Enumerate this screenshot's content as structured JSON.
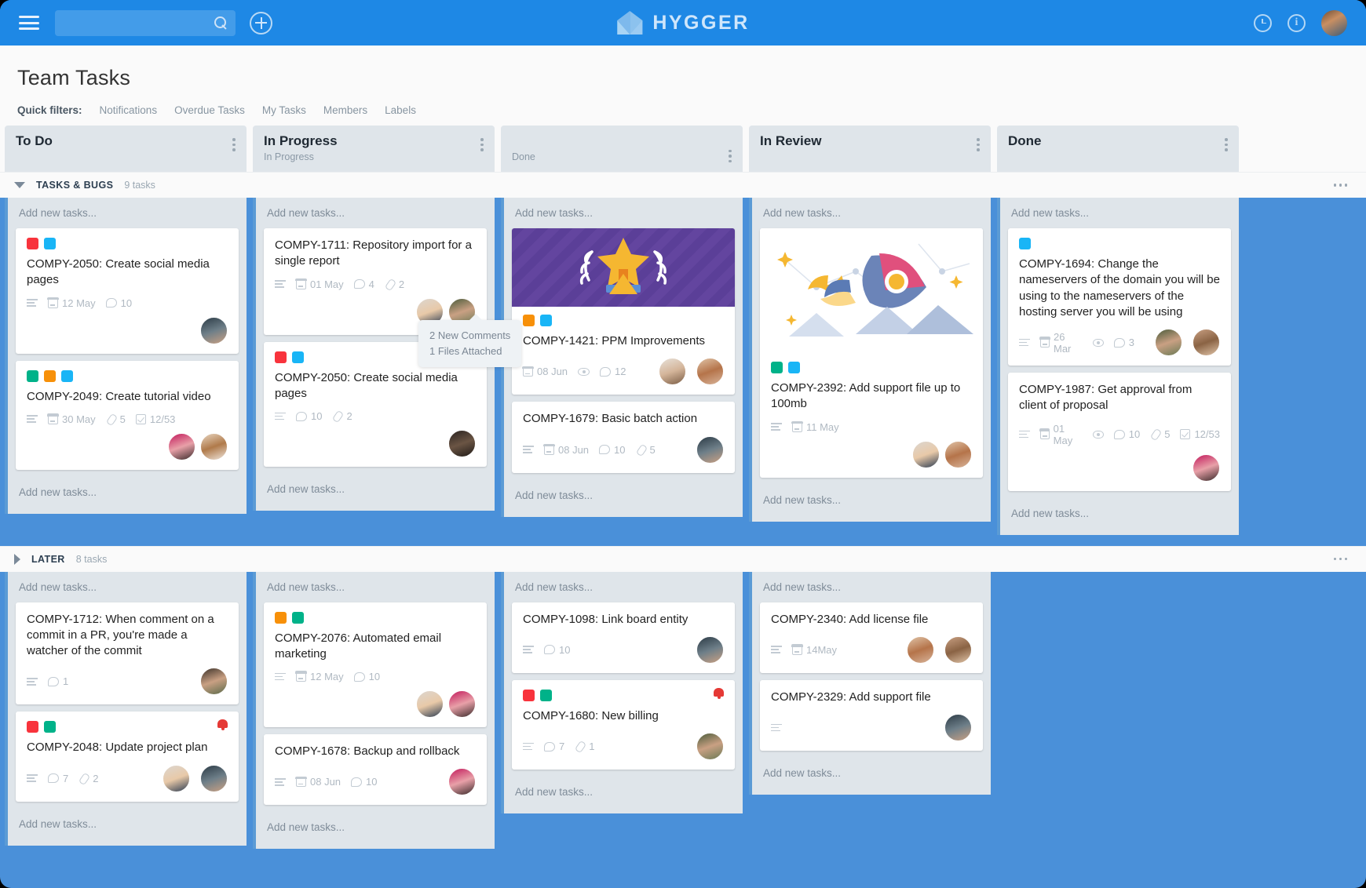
{
  "topbar": {
    "menu_icon": "hamburger-icon",
    "search_placeholder": "",
    "search_value": "",
    "add_icon": "plus-circle-icon",
    "brand": "HYGGER",
    "clock_icon": "clock-icon",
    "info_icon": "info-icon",
    "avatar": "user-avatar"
  },
  "page": {
    "title": "Team Tasks",
    "filters_label": "Quick filters:",
    "filters": [
      "Notifications",
      "Overdue Tasks",
      "My Tasks",
      "Members",
      "Labels"
    ]
  },
  "columns": [
    {
      "title": "To Do",
      "subtitle": ""
    },
    {
      "title": "In Progress",
      "subtitle": "In Progress"
    },
    {
      "title": "",
      "subtitle": "Done"
    },
    {
      "title": "In Review",
      "subtitle": ""
    },
    {
      "title": "Done",
      "subtitle": ""
    }
  ],
  "add_new_text": "Add new tasks...",
  "swimlanes": [
    {
      "name": "TASKS & BUGS",
      "count": "9 tasks",
      "expanded": true
    },
    {
      "name": "LATER",
      "count": "8 tasks",
      "expanded": false
    }
  ],
  "tooltip": {
    "line1": "2 New Comments",
    "line2": "1 Files Attached"
  },
  "label_colors": {
    "red": "#f8333c",
    "cyan": "#19b5f6",
    "green": "#00b289",
    "orange": "#f79009",
    "blue": "#19b5f6"
  },
  "lane1": {
    "todo": [
      {
        "labels": [
          "red",
          "cyan"
        ],
        "title": "COMPY-2050: Create social media pages",
        "desc": true,
        "date": "12 May",
        "comments": "10",
        "avatars": 1
      },
      {
        "labels": [
          "green",
          "orange",
          "cyan"
        ],
        "title": "COMPY-2049: Create tutorial video",
        "desc": true,
        "date": "30 May",
        "files": "5",
        "checklist": "12/53",
        "avatars": 2
      }
    ],
    "inprogress": [
      {
        "labels": [],
        "title": "COMPY-1711: Repository import for a single report",
        "desc": true,
        "date": "01 May",
        "comments": "4",
        "files": "2",
        "avatars": 2
      },
      {
        "labels": [
          "red",
          "cyan"
        ],
        "title": "COMPY-2050: Create social media pages",
        "desc": true,
        "comments": "10",
        "files": "2",
        "avatars": 1,
        "bell": true,
        "tooltip": true
      }
    ],
    "done1": [
      {
        "cover": "trophy",
        "labels": [
          "orange",
          "cyan"
        ],
        "title": "COMPY-1421: PPM Improvements",
        "date": "08 Jun",
        "watch": true,
        "comments": "12",
        "avatars": 2
      },
      {
        "labels": [],
        "title": "COMPY-1679: Basic batch action",
        "desc": true,
        "date": "08 Jun",
        "comments": "10",
        "files": "5",
        "avatars": 1
      }
    ],
    "inreview": [
      {
        "cover": "rocket",
        "labels": [
          "green",
          "cyan"
        ],
        "title": "COMPY-2392: Add support file up to 100mb",
        "desc": true,
        "date": "11 May",
        "avatars": 2
      }
    ],
    "done2": [
      {
        "labels": [
          "cyan"
        ],
        "title": "COMPY-1694: Change the nameservers of the domain you will be using to the nameservers of the hosting server you will be using",
        "desc": true,
        "date": "26 Mar",
        "watch": true,
        "comments": "3",
        "avatars": 2
      },
      {
        "labels": [],
        "title": "COMPY-1987: Get approval from client of proposal",
        "desc": true,
        "date": "01 May",
        "watch": true,
        "comments": "10",
        "files": "5",
        "checklist": "12/53",
        "avatars": 1
      }
    ]
  },
  "lane2": {
    "todo": [
      {
        "labels": [],
        "title": "COMPY-1712: When comment on a commit in a PR, you're made a watcher of the commit",
        "desc": true,
        "comments": "1",
        "avatars": 1
      },
      {
        "labels": [
          "red",
          "green"
        ],
        "title": "COMPY-2048: Update project plan",
        "desc": true,
        "comments": "7",
        "files": "2",
        "avatars": 2,
        "bell": true
      }
    ],
    "inprogress": [
      {
        "labels": [
          "orange",
          "green"
        ],
        "title": "COMPY-2076: Automated email marketing",
        "desc": true,
        "date": "12 May",
        "comments": "10",
        "avatars": 2
      },
      {
        "labels": [],
        "title": "COMPY-1678: Backup and rollback",
        "desc": true,
        "date": "08 Jun",
        "comments": "10",
        "avatars": 1
      }
    ],
    "done1": [
      {
        "labels": [],
        "title": "COMPY-1098: Link board entity",
        "desc": true,
        "comments": "10",
        "avatars": 1
      },
      {
        "labels": [
          "red",
          "green"
        ],
        "title": "COMPY-1680: New billing",
        "desc": true,
        "comments": "7",
        "files": "1",
        "avatars": 1,
        "bell": true
      }
    ],
    "inreview": [
      {
        "labels": [],
        "title": "COMPY-2340: Add license file",
        "desc": true,
        "date": "14May",
        "avatars": 2
      },
      {
        "labels": [],
        "title": "COMPY-2329: Add support file",
        "desc": true,
        "avatars": 1
      }
    ]
  }
}
